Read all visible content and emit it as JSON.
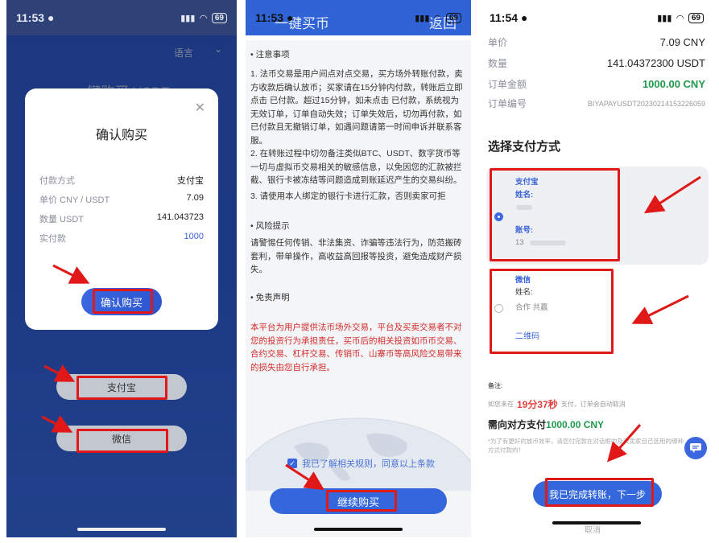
{
  "panel1": {
    "status": {
      "time": "11:53",
      "battery": "69"
    },
    "lang_label": "语言",
    "bg_title": "一键购买 USDT",
    "modal": {
      "title": "确认购买",
      "rows": [
        {
          "label": "付款方式",
          "value": "支付宝"
        },
        {
          "label": "单价 CNY / USDT",
          "value": "7.09"
        },
        {
          "label": "数量 USDT",
          "value": "141.043723"
        },
        {
          "label": "实付款",
          "value": "1000"
        }
      ],
      "confirm_label": "确认购买"
    },
    "alipay_label": "支付宝",
    "wechat_label": "微信"
  },
  "panel2": {
    "status": {
      "time": "11:53",
      "battery": "69"
    },
    "header_title": "一键买币",
    "back_label": "返回",
    "notice_heading": "• 注意事项",
    "notice_1": "1. 法币交易是用户间点对点交易，买方场外转账付款，卖方收款后确认放币；买家请在15分钟内付款，转账后立即点击 已付款。超过15分钟，如未点击 已付款，系统视为无效订单，订单自动失效；订单失效后，切勿再付款，如已付款且无撤销订单，如遇问题请第一时间申诉并联系客服。",
    "notice_2": "2. 在转账过程中切勿备注类似BTC、USDT、数字货币等一切与虚拟币交易相关的敏感信息，以免因您的汇款被拦截、银行卡被冻结等问题造成到账延迟产生的交易纠纷。",
    "notice_3": "3. 请使用本人绑定的银行卡进行汇款，否则卖家可拒",
    "risk_heading": "• 风险提示",
    "risk_text": "请警惕任何传销、非法集资、诈骗等违法行为，防范搬砖套利，带单操作，高收益高回报等投资，避免造成财产损失。",
    "disclaimer_heading": "• 免责声明",
    "disclaimer_text": "本平台为用户提供法币场外交易，平台及买卖交易者不对您的投资行为承担责任，买币后的相关投资如币币交易、合约交易、杠杆交易、传销币、山寨币等高风险交易带来的损失由您自行承担。",
    "agree_label": "我已了解相关规则，同意以上条款",
    "continue_label": "继续购买"
  },
  "panel3": {
    "status": {
      "time": "11:54",
      "battery": "69"
    },
    "rows": [
      {
        "label": "单价",
        "value": "7.09 CNY"
      },
      {
        "label": "数量",
        "value": "141.04372300 USDT"
      },
      {
        "label": "订单金额",
        "value": "1000.00 CNY"
      },
      {
        "label": "订单编号",
        "value": "BIYAPAYUSDT20230214153226059"
      }
    ],
    "section_title": "选择支付方式",
    "alipay": {
      "title": "支付宝",
      "name_label": "姓名:",
      "account_label": "账号:",
      "account_prefix": "13"
    },
    "wechat": {
      "title": "微信",
      "name_label": "姓名:",
      "name_value": "合作 共赢",
      "qrcode_label": "二维码"
    },
    "note_label": "备注:",
    "timer_prefix": "如您未在",
    "timer_value": "19分37秒",
    "timer_suffix": "支付，订单会自动取消",
    "need_prefix": "需向对方支付",
    "need_amount": "1000.00 CNY",
    "fine_print": "*为了有更好的放币效率，请您付完款在对话框中及表卖家自己选用的哪种方式付款的！",
    "next_label": "我已完成转账，下一步",
    "cancel_label": "取消"
  }
}
